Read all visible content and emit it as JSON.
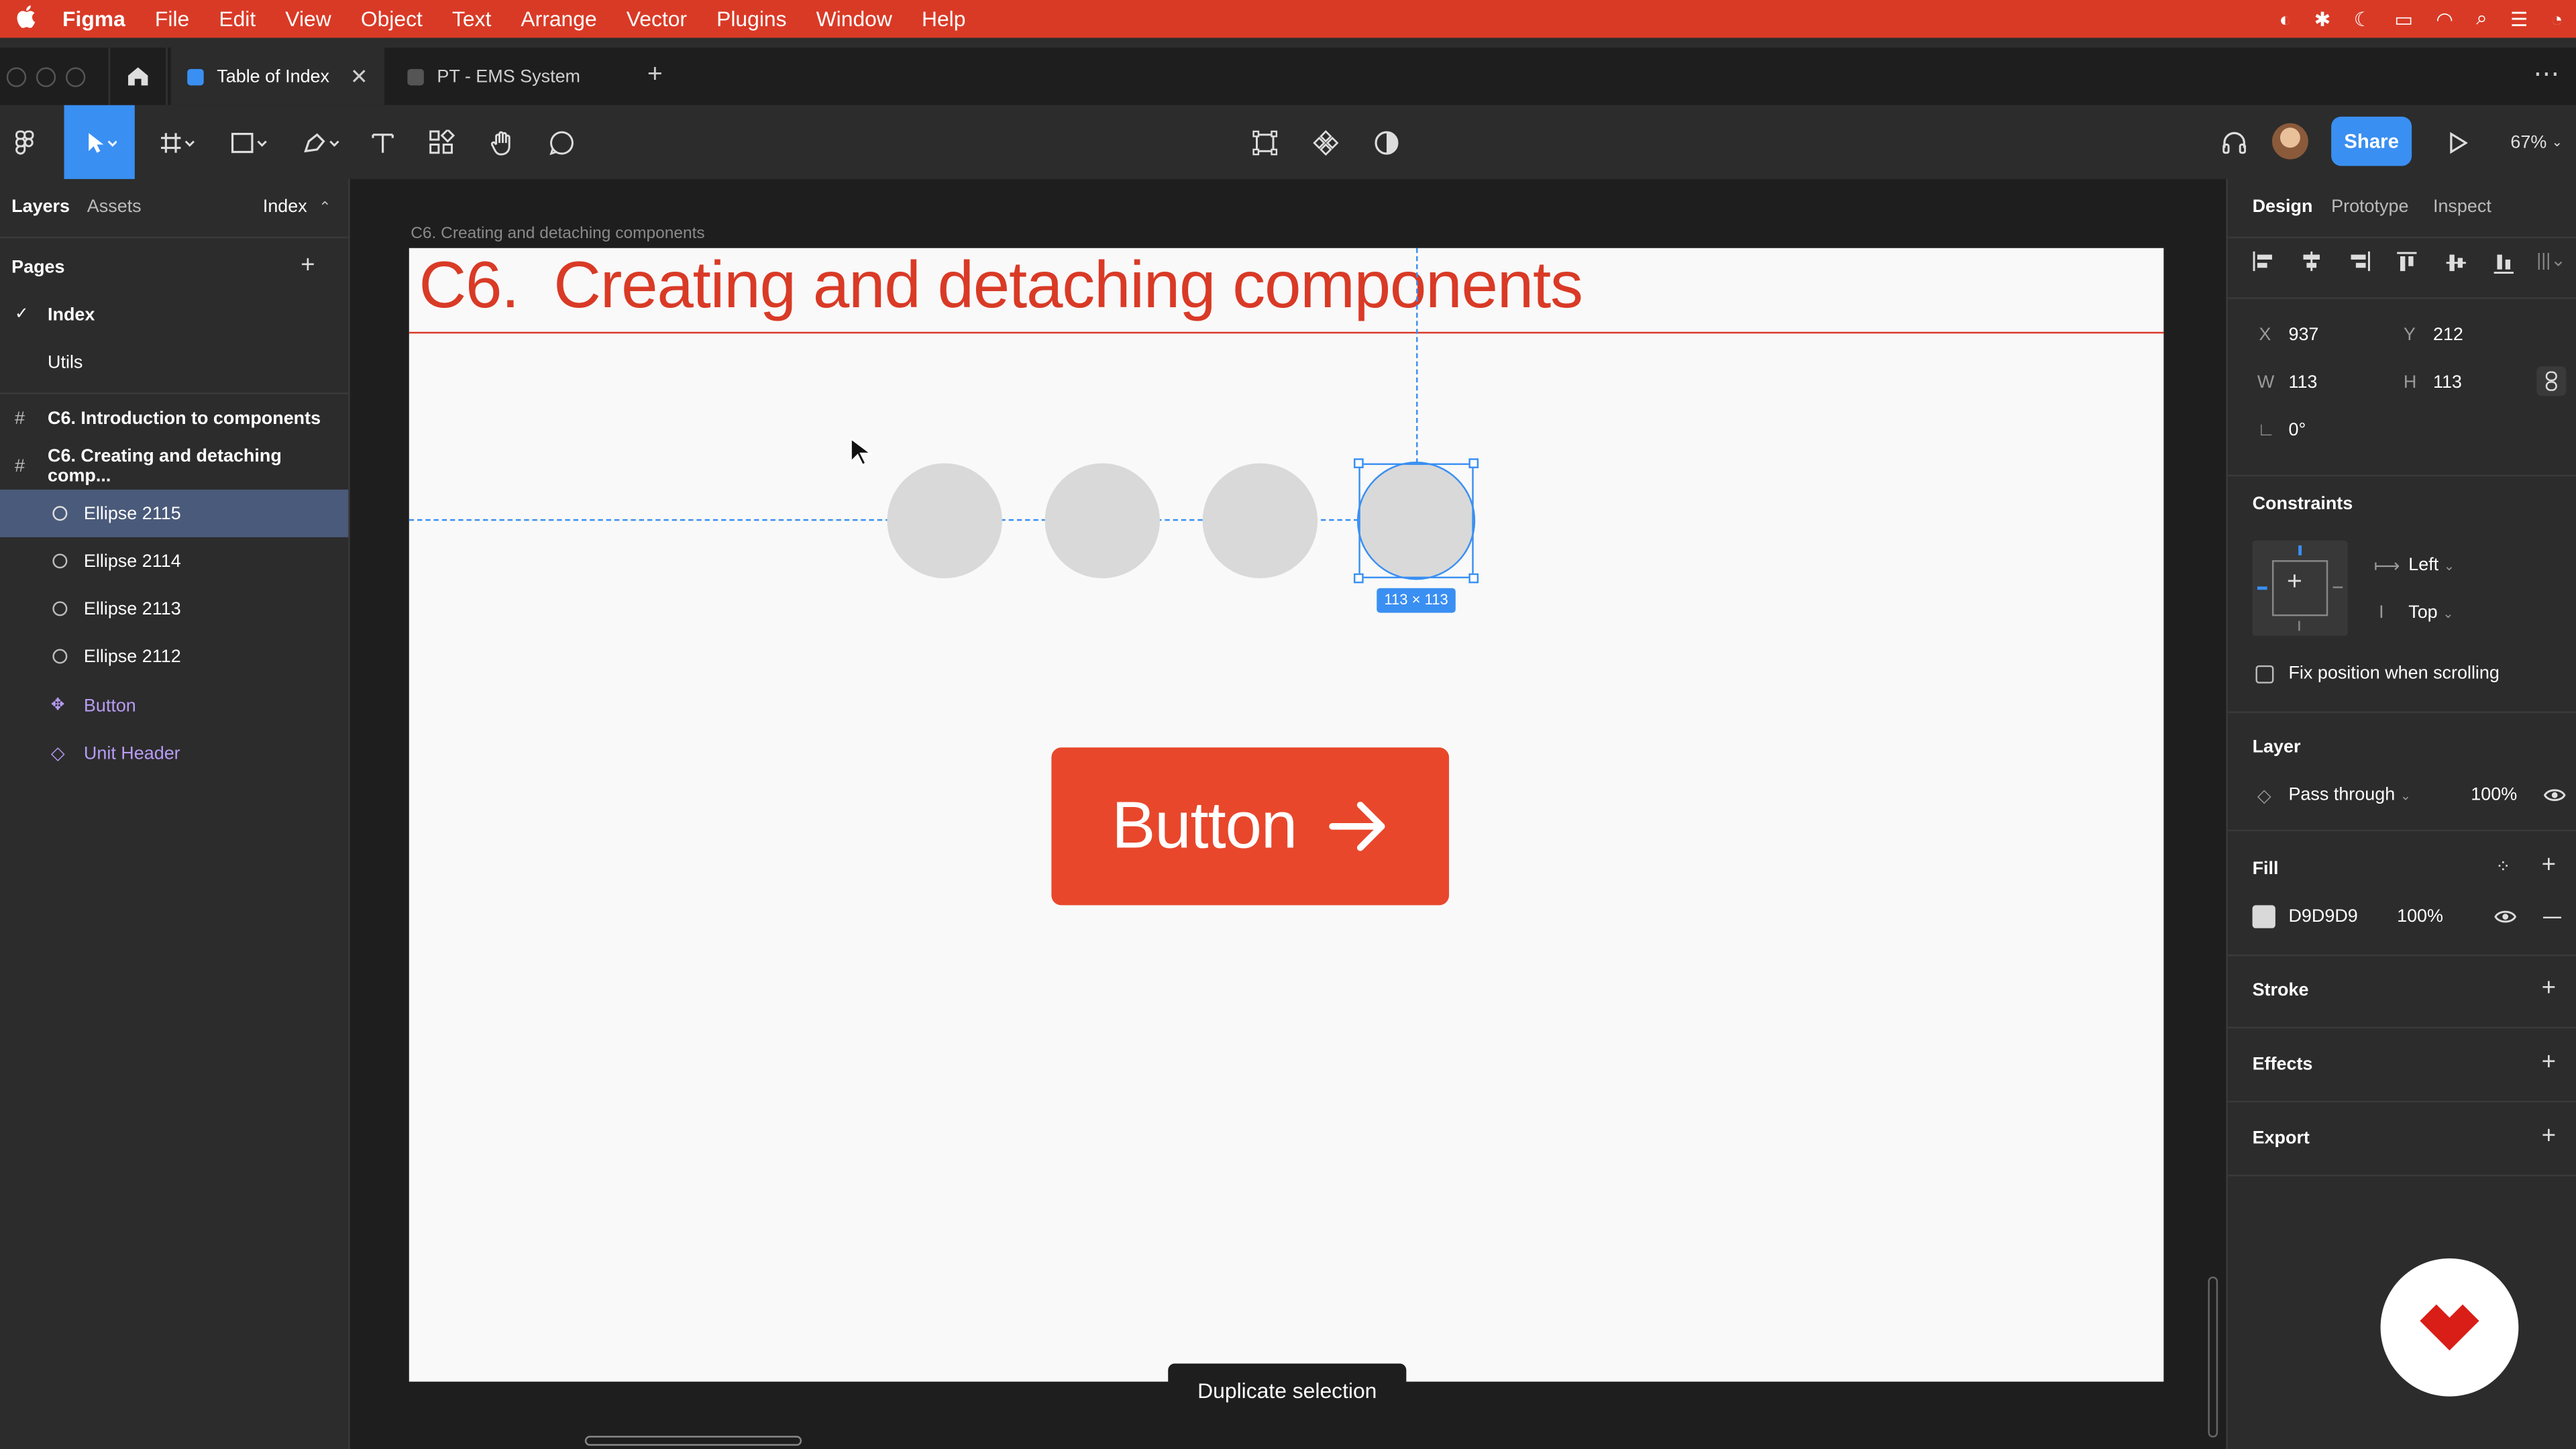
{
  "menubar": {
    "apple": "",
    "app": "Figma",
    "items": [
      "File",
      "Edit",
      "View",
      "Object",
      "Text",
      "Arrange",
      "Vector",
      "Plugins",
      "Window",
      "Help"
    ]
  },
  "tabs": [
    {
      "label": "Table of Index",
      "active": true
    },
    {
      "label": "PT - EMS System",
      "active": false
    }
  ],
  "toolbar": {
    "share_label": "Share",
    "zoom": "67%"
  },
  "left_panel": {
    "tabs": {
      "layers": "Layers",
      "assets": "Assets",
      "page_switch": "Index"
    },
    "pages_header": "Pages",
    "pages": [
      {
        "label": "Index",
        "checked": true
      },
      {
        "label": "Utils",
        "checked": false
      }
    ],
    "frames": [
      {
        "label": "C6. Introduction to components"
      },
      {
        "label": "C6. Creating and detaching comp..."
      }
    ],
    "layers": [
      {
        "label": "Ellipse 2115",
        "icon": "ellipse-icon"
      },
      {
        "label": "Ellipse 2114",
        "icon": "ellipse-icon"
      },
      {
        "label": "Ellipse 2113",
        "icon": "ellipse-icon"
      },
      {
        "label": "Ellipse 2112",
        "icon": "ellipse-icon"
      },
      {
        "label": "Button",
        "icon": "component-instance-icon"
      },
      {
        "label": "Unit Header",
        "icon": "component-instance-icon"
      }
    ]
  },
  "canvas": {
    "frame_label": "C6. Creating and detaching components",
    "heading": "C6.  Creating and detaching components",
    "size_badge": "113 × 113",
    "button_label": "Button",
    "toast": "Duplicate selection"
  },
  "right_panel": {
    "tabs": {
      "design": "Design",
      "prototype": "Prototype",
      "inspect": "Inspect"
    },
    "x_label": "X",
    "x_value": "937",
    "y_label": "Y",
    "y_value": "212",
    "w_label": "W",
    "w_value": "113",
    "h_label": "H",
    "h_value": "113",
    "rotation": "0°",
    "constraints_header": "Constraints",
    "constraint_h": "Left",
    "constraint_v": "Top",
    "fix_position": "Fix position when scrolling",
    "layer_header": "Layer",
    "blend_mode": "Pass through",
    "layer_opacity": "100%",
    "fill_header": "Fill",
    "fill_hex": "D9D9D9",
    "fill_opacity": "100%",
    "stroke_header": "Stroke",
    "effects_header": "Effects",
    "export_header": "Export"
  },
  "colors": {
    "menubar": "#d93a26",
    "accent": "#3a8ff2",
    "heading": "#d93a26",
    "button": "#e8472b",
    "ellipse_fill": "#d9d9d9"
  }
}
